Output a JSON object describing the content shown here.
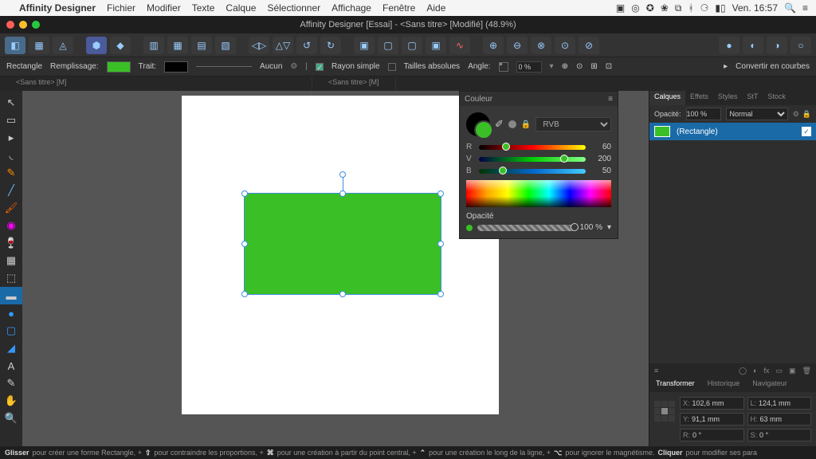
{
  "mac": {
    "apple": "",
    "app": "Affinity Designer",
    "menus": [
      "Fichier",
      "Modifier",
      "Texte",
      "Calque",
      "Sélectionner",
      "Affichage",
      "Fenêtre",
      "Aide"
    ],
    "clock": "Ven. 16:57"
  },
  "title": "Affinity Designer [Essai] - <Sans titre> [Modifié] (48.9%)",
  "context": {
    "tool": "Rectangle",
    "fill_label": "Remplissage:",
    "stroke_label": "Trait:",
    "stroke_val": "Aucun",
    "single_ray": "Rayon simple",
    "abs_sizes": "Tailles absolues",
    "angle_label": "Angle:",
    "angle_val": "0 %",
    "convert": "Convertir en courbes"
  },
  "tabs": [
    "<Sans titre> [M]",
    "<Sans titre> [M]"
  ],
  "color_panel": {
    "title": "Couleur",
    "mode": "RVB",
    "r_label": "R",
    "r_val": "60",
    "g_label": "V",
    "g_val": "200",
    "b_label": "B",
    "b_val": "50",
    "op_label": "Opacité",
    "op_val": "100 %"
  },
  "layers": {
    "tabs": [
      "Calques",
      "Effets",
      "Styles",
      "StT",
      "Stock"
    ],
    "op_label": "Opacité:",
    "op_val": "100 %",
    "blend": "Normal",
    "layer_name": "(Rectangle)"
  },
  "transformer": {
    "tabs": [
      "Transformer",
      "Historique",
      "Navigateur"
    ],
    "x_l": "X:",
    "x": "102,6 mm",
    "y_l": "Y:",
    "y": "91,1 mm",
    "w_l": "L:",
    "w": "124,1 mm",
    "h_l": "H:",
    "h": "63 mm",
    "r_l": "R:",
    "r": "0 °",
    "s_l": "S:",
    "s": "0 °"
  },
  "status": {
    "t1": "Glisser",
    "t2": " pour créer une forme Rectangle, +",
    "t3": "⇧",
    "t4": " pour contraindre les proportions, +",
    "t5": "⌘",
    "t6": " pour une création à partir du point central, +",
    "t7": "⌃",
    "t8": " pour une création le long de la ligne, +",
    "t9": "⌥",
    "t10": " pour ignorer le magnétisme. ",
    "t11": "Cliquer",
    "t12": " pour modifier ses para"
  }
}
